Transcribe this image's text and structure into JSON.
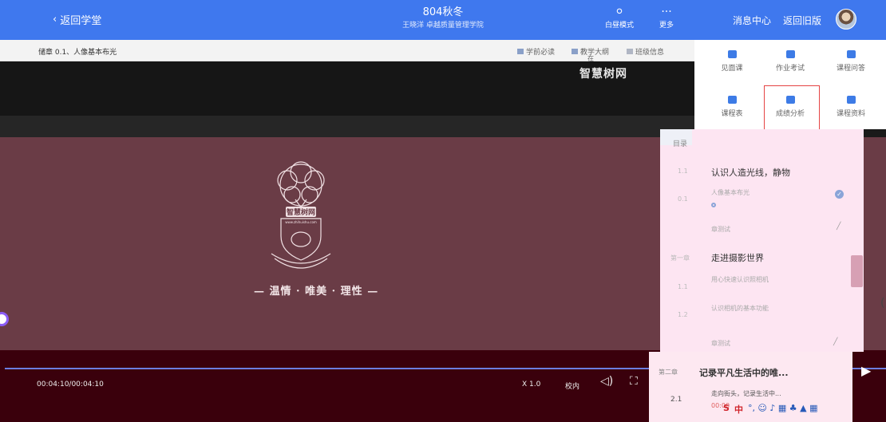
{
  "topbar": {
    "back_label": "返回学堂",
    "course_title": "804秋冬",
    "course_subtitle": "王晓洋   卓越质量管理学院",
    "mode_label": "白昼模式",
    "more_dots": "···",
    "more_label": "更多",
    "message_center": "消息中心",
    "return_old": "返回旧版"
  },
  "infobar": {
    "chapter": "储章 0.1、人像基本布光",
    "items": [
      {
        "label": "学前必读"
      },
      {
        "label": "教学大纲"
      },
      {
        "label": "班级信息"
      }
    ],
    "overflow_char": "在"
  },
  "video": {
    "watermark": "智慧树网",
    "logo_text": "智慧树网",
    "logo_url": "www.zhihuishu.com",
    "slogan": "— 温情 · 唯美 · 理性 —",
    "time": "00:04:10/00:04:10",
    "speed": "X 1.0",
    "quality": "校内"
  },
  "quick_panel": {
    "items": [
      {
        "label": "见面课"
      },
      {
        "label": "作业考试"
      },
      {
        "label": "课程问答"
      },
      {
        "label": "课程表"
      },
      {
        "label": "成绩分析"
      },
      {
        "label": "课程资料"
      }
    ]
  },
  "catalog": {
    "head": "目录",
    "sections": [
      {
        "num": "1.1",
        "title": "认识人造光线，静物"
      },
      {
        "num": "第一章",
        "title": "走进摄影世界"
      },
      {
        "num": "第二章",
        "title": "记录平凡生活中的唯..."
      }
    ],
    "lessons": [
      {
        "num": "0.1",
        "label": "人像基本布光"
      },
      {
        "num": "",
        "label": "章测试"
      },
      {
        "num": "1.1",
        "label": "用心快速认识照相机"
      },
      {
        "num": "1.2",
        "label": "认识相机的基本功能"
      },
      {
        "num": "",
        "label": "章测试"
      },
      {
        "num": "2.1",
        "label": "走向街头，记录生活中..."
      }
    ],
    "lesson_time": "00:00"
  },
  "ime": {
    "label": "中",
    "extras": "°, ☺ ♪ ▦ ♣ ▲ ▦"
  },
  "colors": {
    "topbar": "#3f78ee",
    "stage": "#6a3c46",
    "progress": "#6c7ee0",
    "highlight": "#e54343"
  }
}
